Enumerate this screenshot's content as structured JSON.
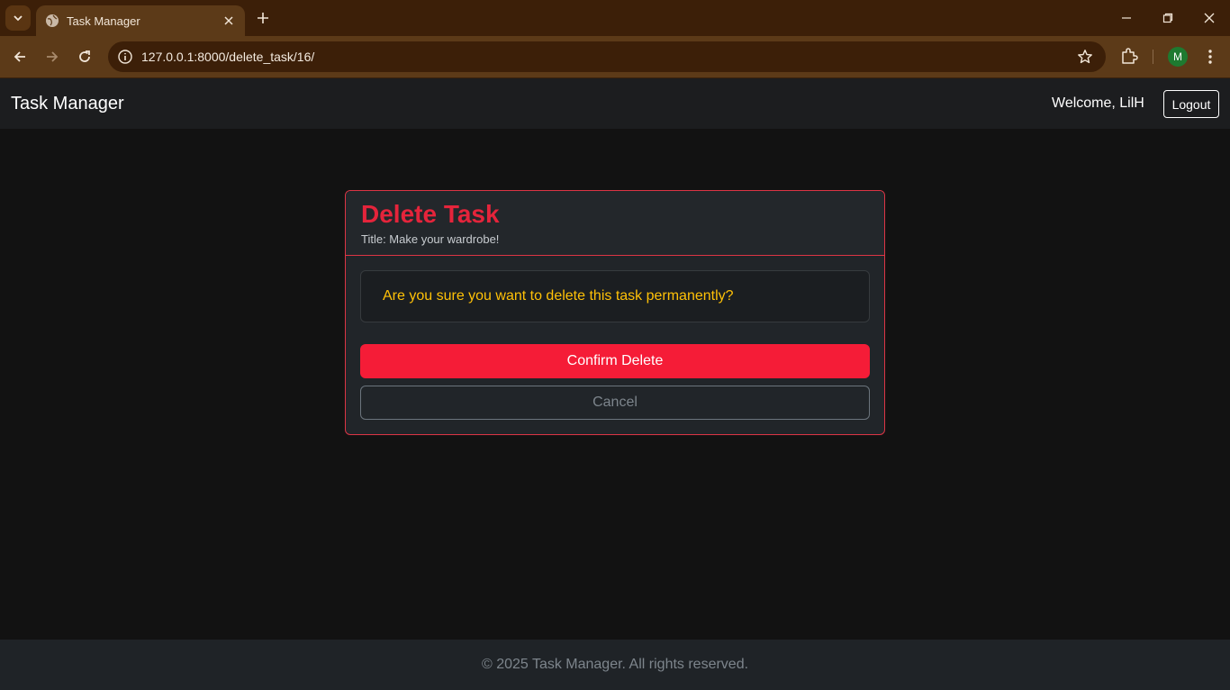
{
  "browser": {
    "tab_title": "Task Manager",
    "url": "127.0.0.1:8000/delete_task/16/",
    "profile_initial": "M"
  },
  "navbar": {
    "brand": "Task Manager",
    "welcome": "Welcome, LilH",
    "logout_label": "Logout"
  },
  "card": {
    "title": "Delete Task",
    "subtitle": "Title: Make your wardrobe!",
    "warning": "Are you sure you want to delete this task permanently?",
    "confirm_label": "Confirm Delete",
    "cancel_label": "Cancel"
  },
  "footer": {
    "text": "© 2025 Task Manager. All rights reserved."
  },
  "colors": {
    "danger": "#dc3545",
    "warning": "#ffc107",
    "chrome": "#5c3a18"
  }
}
